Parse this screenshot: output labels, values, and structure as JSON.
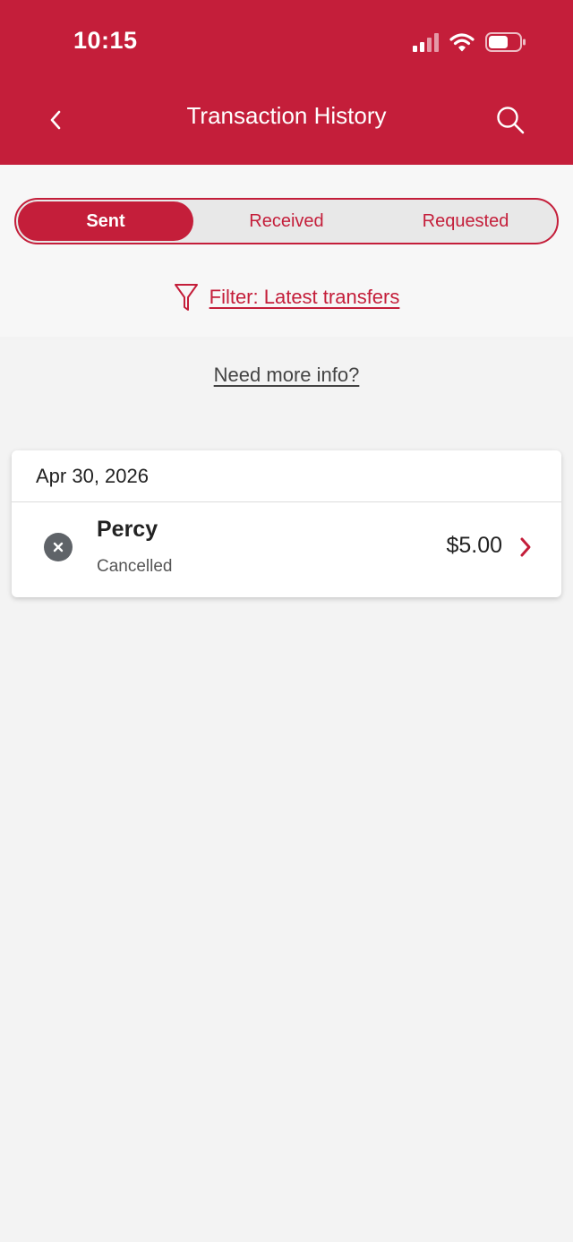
{
  "status_bar": {
    "time": "10:15"
  },
  "header": {
    "title": "Transaction History",
    "back_icon": "chevron-left-icon",
    "search_icon": "search-icon"
  },
  "tabs": [
    {
      "label": "Sent",
      "active": true
    },
    {
      "label": "Received",
      "active": false
    },
    {
      "label": "Requested",
      "active": false
    }
  ],
  "filter": {
    "label": "Filter: Latest transfers",
    "icon": "filter-icon"
  },
  "help_link": "Need more info?",
  "transactions": [
    {
      "date": "Apr 30, 2026",
      "items": [
        {
          "name": "Percy",
          "status": "Cancelled",
          "amount": "$5.00",
          "status_icon": "cancelled-icon"
        }
      ]
    }
  ],
  "colors": {
    "brand": "#c41e3a",
    "background": "#f3f3f3",
    "status_icon": "#5f6368"
  }
}
